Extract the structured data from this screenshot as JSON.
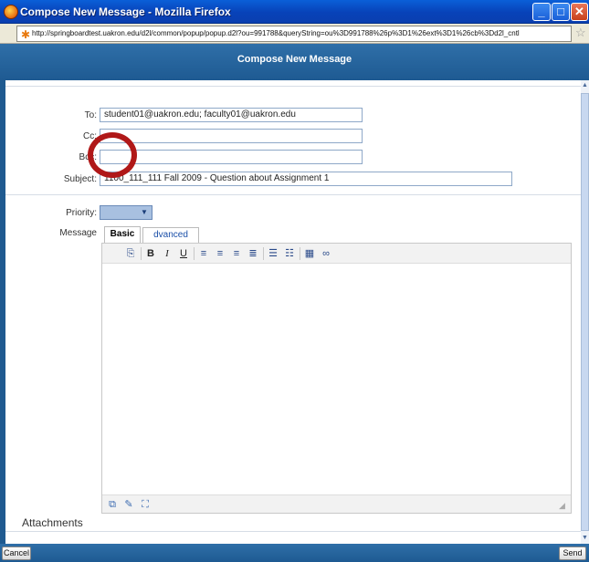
{
  "window": {
    "title": "Compose New Message - Mozilla Firefox"
  },
  "browser": {
    "url": "http://springboardtest.uakron.edu/d2l/common/popup/popup.d2l?ou=991788&queryString=ou%3D991788%26p%3D1%26ext%3D1%26cb%3Dd2l_cntl"
  },
  "header": {
    "title": "Compose New Message"
  },
  "form": {
    "to_label": "To:",
    "to_value": "student01@uakron.edu; faculty01@uakron.edu",
    "cc_label": "Cc:",
    "cc_value": "",
    "bcc_label": "Bcc:",
    "bcc_value": "",
    "subject_label": "Subject:",
    "subject_value": "1100_111_111 Fall 2009 - Question about Assignment 1",
    "priority_label": "Priority:",
    "priority_value": "",
    "message_label": "Message"
  },
  "editor": {
    "tabs": [
      {
        "label": "Basic",
        "active": true
      },
      {
        "label": "dvanced",
        "active": false
      }
    ],
    "toolbar_icons": [
      "paste-icon",
      "bold-icon",
      "italic-icon",
      "underline-icon",
      "align-left-icon",
      "align-center-icon",
      "align-right-icon",
      "justify-icon",
      "bullet-list-icon",
      "numbered-list-icon",
      "table-icon",
      "link-icon"
    ],
    "bold_glyph": "B",
    "italic_glyph": "I",
    "underline_glyph": "U"
  },
  "attachments": {
    "label": "Attachments"
  },
  "footer": {
    "cancel_label": "Cancel",
    "send_label": "Send"
  },
  "colors": {
    "header": "#1e5a92",
    "highlight_ring": "#b01818",
    "link": "#1a4fa8"
  }
}
